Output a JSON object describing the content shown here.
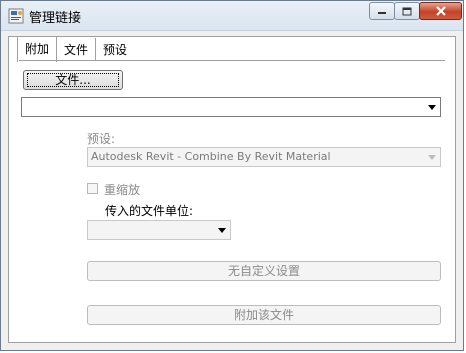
{
  "window": {
    "title": "管理链接",
    "icons": {
      "app": "link-manager-icon",
      "minimize": "minimize-icon",
      "maximize": "maximize-icon",
      "close": "close-icon"
    },
    "colors": {
      "close_button": "#c4432a",
      "titlebar": "#dbe5f0",
      "disabled_text": "#8a8a8a"
    }
  },
  "tabs": [
    {
      "label": "附加",
      "active": true
    },
    {
      "label": "文件",
      "active": false
    },
    {
      "label": "预设",
      "active": false
    }
  ],
  "attach_tab": {
    "file_button_label": "文件...",
    "path_value": "",
    "preset_label": "预设:",
    "preset_value": "Autodesk Revit - Combine By Revit  Material",
    "rescale_label": "重缩放",
    "rescale_checked": false,
    "units_label": "传入的文件单位:",
    "units_value": "",
    "custom_settings_label": "无自定义设置",
    "attach_button_label": "附加该文件"
  }
}
